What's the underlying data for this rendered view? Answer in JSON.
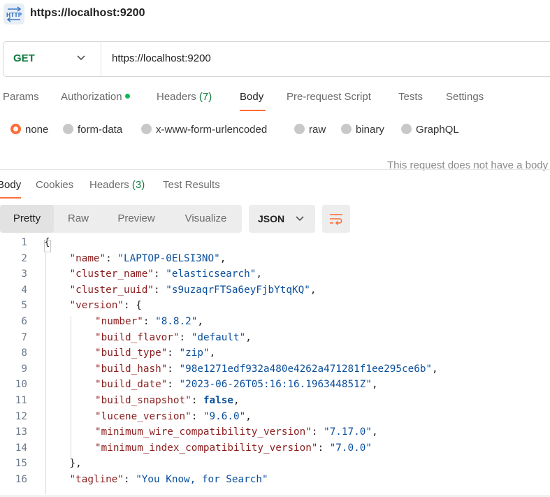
{
  "title_bar": {
    "icon": "http-icon",
    "title": "https://localhost:9200"
  },
  "request": {
    "method": "GET",
    "url": "https://localhost:9200"
  },
  "request_tabs": [
    {
      "label": "Params"
    },
    {
      "label": "Authorization"
    },
    {
      "label": "Headers",
      "count": "(7)"
    },
    {
      "label": "Body"
    },
    {
      "label": "Pre-request Script"
    },
    {
      "label": "Tests"
    },
    {
      "label": "Settings"
    }
  ],
  "body_types": [
    "none",
    "form-data",
    "x-www-form-urlencoded",
    "raw",
    "binary",
    "GraphQL"
  ],
  "body_type_selected": "none",
  "no_body_message": "This request does not have a body",
  "response_tabs": [
    {
      "label": "Body"
    },
    {
      "label": "Cookies"
    },
    {
      "label": "Headers",
      "count": "(3)"
    },
    {
      "label": "Test Results"
    }
  ],
  "view_modes": [
    "Pretty",
    "Raw",
    "Preview",
    "Visualize"
  ],
  "view_mode_selected": "Pretty",
  "format": "JSON",
  "colors": {
    "accent": "#ff6c37",
    "method": "#0f7b3e",
    "json_key": "#8b1e1e",
    "json_value": "#0a4f9c"
  },
  "response_json": [
    {
      "n": "1",
      "text": "{"
    },
    {
      "n": "2",
      "key": "\"name\"",
      "value": "\"LAPTOP-0ELSI3NO\"",
      "tail": ","
    },
    {
      "n": "3",
      "key": "\"cluster_name\"",
      "value": "\"elasticsearch\"",
      "tail": ","
    },
    {
      "n": "4",
      "key": "\"cluster_uuid\"",
      "value": "\"s9uzaqrFTSa6eyFjbYtqKQ\"",
      "tail": ","
    },
    {
      "n": "5",
      "key": "\"version\"",
      "value": "{",
      "tail": ""
    },
    {
      "n": "6",
      "key": "\"number\"",
      "value": "\"8.8.2\"",
      "tail": ","
    },
    {
      "n": "7",
      "key": "\"build_flavor\"",
      "value": "\"default\"",
      "tail": ","
    },
    {
      "n": "8",
      "key": "\"build_type\"",
      "value": "\"zip\"",
      "tail": ","
    },
    {
      "n": "9",
      "key": "\"build_hash\"",
      "value": "\"98e1271edf932a480e4262a471281f1ee295ce6b\"",
      "tail": ","
    },
    {
      "n": "10",
      "key": "\"build_date\"",
      "value": "\"2023-06-26T05:16:16.196344851Z\"",
      "tail": ","
    },
    {
      "n": "11",
      "key": "\"build_snapshot\"",
      "value": "false",
      "tail": ",",
      "bool": true
    },
    {
      "n": "12",
      "key": "\"lucene_version\"",
      "value": "\"9.6.0\"",
      "tail": ","
    },
    {
      "n": "13",
      "key": "\"minimum_wire_compatibility_version\"",
      "value": "\"7.17.0\"",
      "tail": ","
    },
    {
      "n": "14",
      "key": "\"minimum_index_compatibility_version\"",
      "value": "\"7.0.0\"",
      "tail": ""
    },
    {
      "n": "15",
      "text": "},"
    },
    {
      "n": "16",
      "key": "\"tagline\"",
      "value": "\"You Know, for Search\"",
      "tail": ""
    }
  ]
}
